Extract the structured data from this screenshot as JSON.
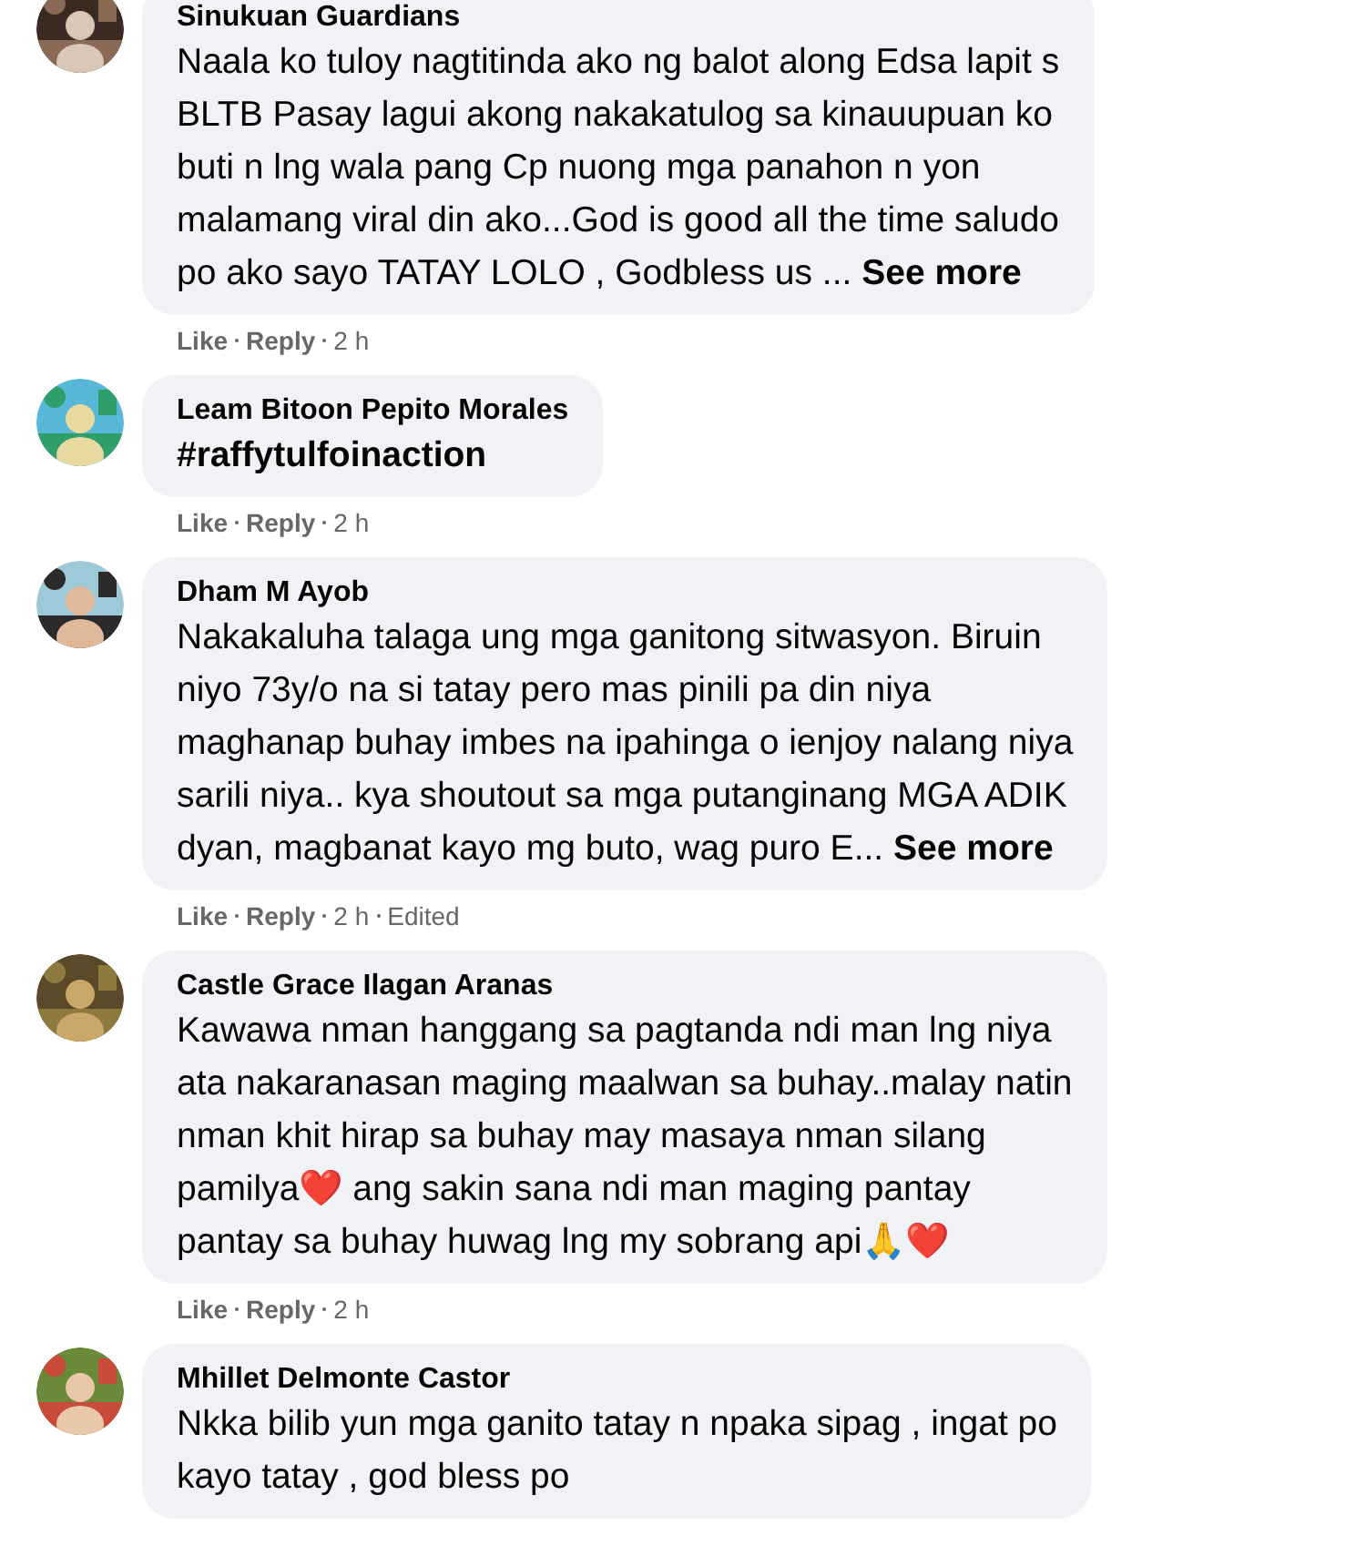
{
  "comments": [
    {
      "author": "Sinukuan Guardians",
      "text": "Naala ko tuloy nagtitinda ako ng balot along Edsa lapit s\nBLTB Pasay lagui akong nakakatulog sa kinauupuan ko\nbuti n lng wala pang Cp nuong mga panahon n yon\nmalamang viral din ako...God is good all the time saludo\npo ako sayo TATAY LOLO , Godbless us ...",
      "see_more": "See more",
      "actions": [
        "Like",
        "Reply"
      ],
      "time": "2 h"
    },
    {
      "author": "Leam Bitoon Pepito Morales",
      "text": "#raffytulfoinaction",
      "bold_text": true,
      "actions": [
        "Like",
        "Reply"
      ],
      "time": "2 h"
    },
    {
      "author": "Dham M Ayob",
      "text": "Nakakaluha talaga ung mga ganitong sitwasyon. Biruin\nniyo 73y/o na si tatay pero mas pinili pa din niya\nmaghanap buhay imbes na ipahinga o ienjoy nalang niya\nsarili niya.. kya shoutout sa mga putanginang MGA ADIK\ndyan, magbanat kayo mg buto, wag puro E...",
      "see_more": "See more",
      "actions": [
        "Like",
        "Reply"
      ],
      "time": "2 h",
      "edited": "Edited"
    },
    {
      "author": "Castle Grace Ilagan Aranas",
      "text": "Kawawa nman hanggang sa pagtanda ndi man lng niya\nata nakaranasan maging maalwan sa buhay..malay natin\nnman khit hirap sa buhay may masaya nman silang\npamilya❤️ ang sakin sana ndi man maging pantay\npantay sa buhay huwag lng my sobrang api🙏❤️",
      "actions": [
        "Like",
        "Reply"
      ],
      "time": "2 h"
    },
    {
      "author": "Mhillet Delmonte Castor",
      "text": "Nkka bilib yun mga ganito tatay n npaka sipag , ingat po\nkayo tatay , god bless po"
    }
  ]
}
